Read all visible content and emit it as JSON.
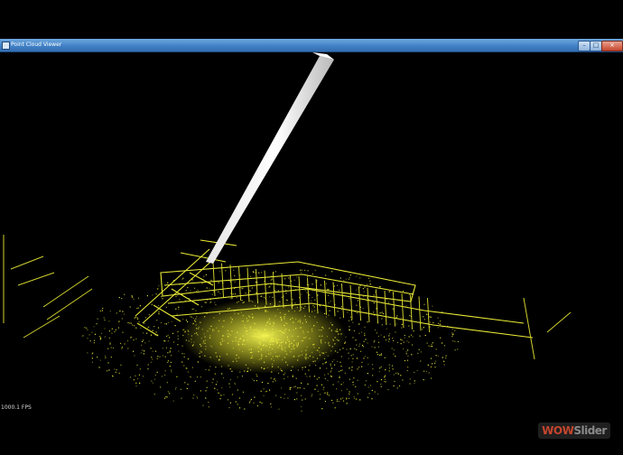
{
  "window": {
    "title": "Point Cloud Viewer",
    "minimize_glyph": "–",
    "maximize_glyph": "□",
    "close_glyph": "×"
  },
  "viewport": {
    "fps": "1000.1 FPS",
    "point_color": "#f2f23a",
    "background_color": "#000000"
  },
  "watermark": {
    "part1": "WOW",
    "part2": "Slider"
  }
}
